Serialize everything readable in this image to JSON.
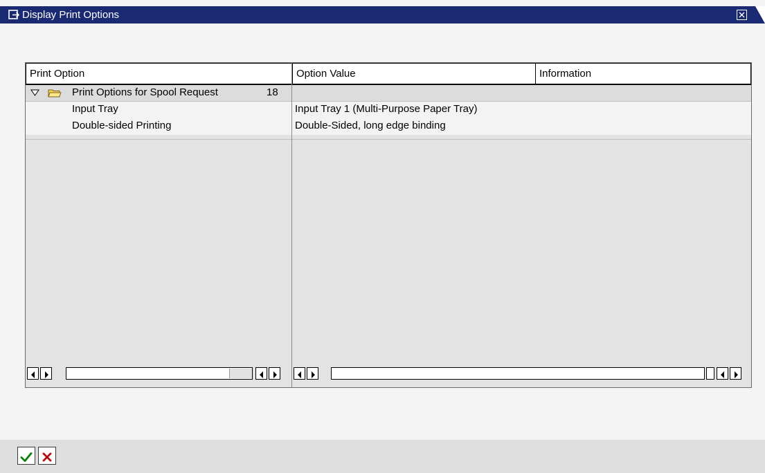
{
  "window": {
    "title": "Display Print Options",
    "colors": {
      "titlebar": "#1a2a72",
      "grid_background": "#e3e3e3",
      "confirm_green": "#1f9e1f",
      "cancel_red": "#d21b1b"
    }
  },
  "grid": {
    "columns": [
      "Print Option",
      "Option Value",
      "Information"
    ],
    "group": {
      "label": "Print Options for Spool Request",
      "number": "18",
      "expanded": true
    },
    "rows": [
      {
        "option": "Input Tray",
        "value": "Input Tray 1 (Multi-Purpose Paper Tray)",
        "information": ""
      },
      {
        "option": "Double-sided Printing",
        "value": "Double-Sided, long edge binding",
        "information": ""
      }
    ]
  },
  "footer": {
    "confirm_icon": "checkmark-icon",
    "cancel_icon": "cancel-x-icon"
  }
}
